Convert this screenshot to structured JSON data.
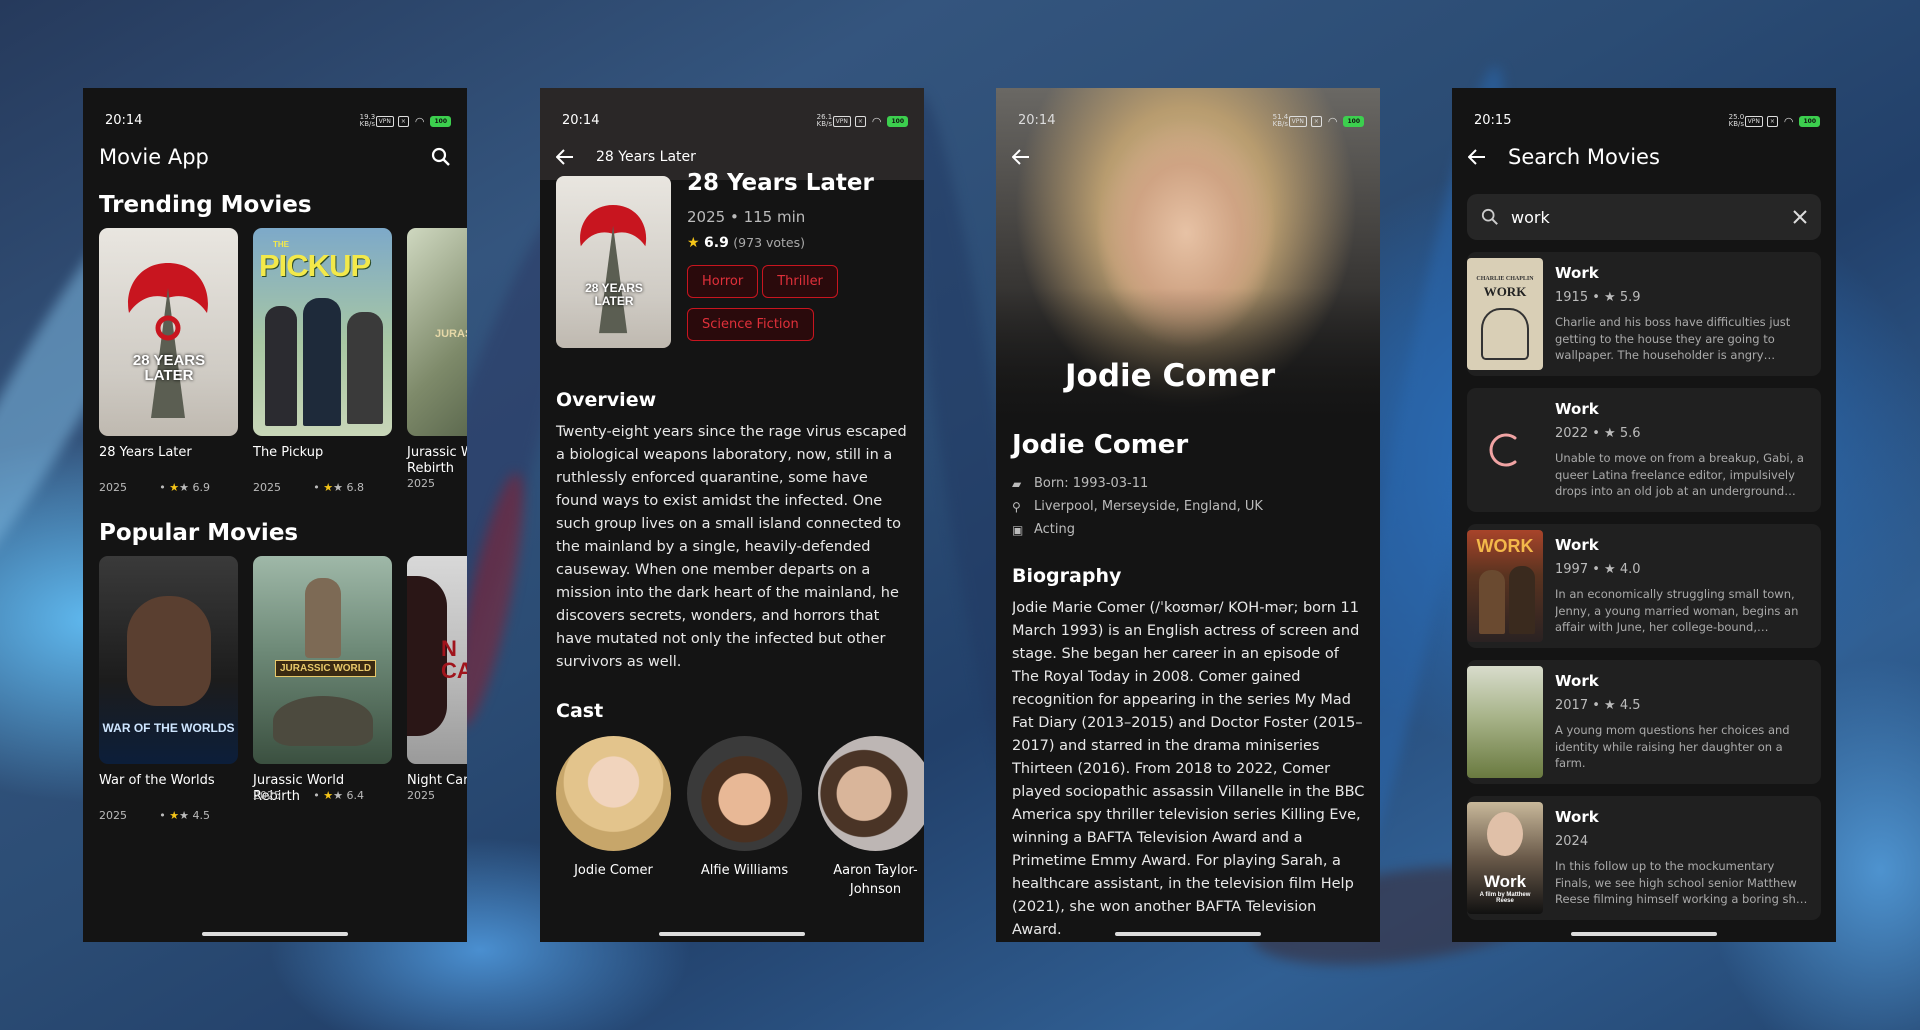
{
  "status": {
    "p1": {
      "time": "20:14",
      "net": "19.3 KB/s"
    },
    "p2": {
      "time": "20:14",
      "net": "26.1 KB/s"
    },
    "p3": {
      "time": "20:14",
      "net": "51.4 KB/s"
    },
    "p4": {
      "time": "20:15",
      "net": "25.0 KB/s"
    },
    "vpn": "VPN",
    "battery": "100"
  },
  "home": {
    "title": "Movie App",
    "trending_title": "Trending Movies",
    "trending": [
      {
        "title": "28 Years Later",
        "year": "2025",
        "rating": "★ 6.9"
      },
      {
        "title": "The Pickup",
        "year": "2025",
        "rating": "★ 6.8"
      },
      {
        "title": "Jurassic World Rebirth",
        "year": "2025"
      }
    ],
    "popular_title": "Popular Movies",
    "popular": [
      {
        "title": "War of the Worlds",
        "year": "2025",
        "rating": "★ 4.5"
      },
      {
        "title": "Jurassic World Rebirth",
        "year": "2025",
        "rating": "★ 6.4"
      },
      {
        "title": "Night Carnage",
        "year": "2025"
      }
    ],
    "poster_text": {
      "p28": "28 YEARS LATER",
      "pickup": "PICKUP",
      "pickup_the": "THE",
      "war": "WAR OF THE WORLDS",
      "jw": "JURASSIC WORLD",
      "jw_short": "JURASS",
      "nc": "N CAR"
    }
  },
  "detail": {
    "appbar_title": "28 Years Later",
    "title": "28 Years Later",
    "year": "2025",
    "runtime": "115 min",
    "rating": "6.9",
    "votes": "(973 votes)",
    "genres": [
      "Horror",
      "Thriller",
      "Science Fiction"
    ],
    "overview_title": "Overview",
    "overview": "Twenty-eight years since the rage virus escaped a biological weapons laboratory, now, still in a ruthlessly enforced quarantine, some have found ways to exist amidst the infected. One such group lives on a small island connected to the mainland by a single, heavily-defended causeway. When one member departs on a mission into the dark heart of the mainland, he discovers secrets, wonders, and horrors that have mutated not only the infected but other survivors as well.",
    "cast_title": "Cast",
    "cast": [
      {
        "name": "Jodie Comer"
      },
      {
        "name": "Alfie Williams"
      },
      {
        "name": "Aaron Taylor-Johnson"
      }
    ]
  },
  "person": {
    "hero_name": "Jodie Comer",
    "name": "Jodie Comer",
    "born": "Born: 1993-03-11",
    "place": "Liverpool, Merseyside, England, UK",
    "dept": "Acting",
    "bio_title": "Biography",
    "bio": "Jodie Marie Comer (/ˈkoʊmər/ KOH-mər; born 11 March 1993) is an English actress of screen and stage. She began her career in an episode of The Royal Today in 2008. Comer gained recognition for appearing in the series My Mad Fat Diary (2013–2015) and Doctor Foster (2015–2017) and starred in the drama miniseries Thirteen (2016). From 2018 to 2022, Comer played sociopathic assassin Villanelle in the BBC America spy thriller television series Killing Eve, winning a BAFTA Television Award and a Primetime Emmy Award. For playing Sarah, a healthcare assistant, in the television film Help (2021), she won another BAFTA Television Award."
  },
  "search": {
    "title": "Search Movies",
    "query": "work",
    "results": [
      {
        "title": "Work",
        "year": "1915",
        "rating": "★ 5.9",
        "desc": "Charlie and his boss have difficulties just getting to the house they are going to wallpaper. The householder is angry because..."
      },
      {
        "title": "Work",
        "year": "2022",
        "rating": "★ 5.6",
        "desc": "Unable to move on from a breakup, Gabi, a queer Latina freelance editor, impulsively drops into an old job at an underground lap..."
      },
      {
        "title": "Work",
        "year": "1997",
        "rating": "★ 4.0",
        "desc": "In an economically struggling small town, Jenny, a young married woman, begins an affair with June, her college-bound, African..."
      },
      {
        "title": "Work",
        "year": "2017",
        "rating": "★ 4.5",
        "desc": "A young mom questions her choices and identity while raising her daughter on a farm."
      },
      {
        "title": "Work",
        "year": "2024",
        "rating": "",
        "desc": "In this follow up to the mockumentary Finals, we see high school senior Matthew Reese filming himself working a boring shift at th..."
      }
    ],
    "thumb_text": {
      "chaplin": "WORK",
      "chaplin_top": "CHARLIE CHAPLIN",
      "work97": "WORK",
      "work24": "Work",
      "work24_sub": "A film by Matthew Reese"
    }
  },
  "colors": {
    "accent_red": "#c8151f",
    "star": "#f5c518",
    "bg": "#141414",
    "card": "#202020"
  }
}
